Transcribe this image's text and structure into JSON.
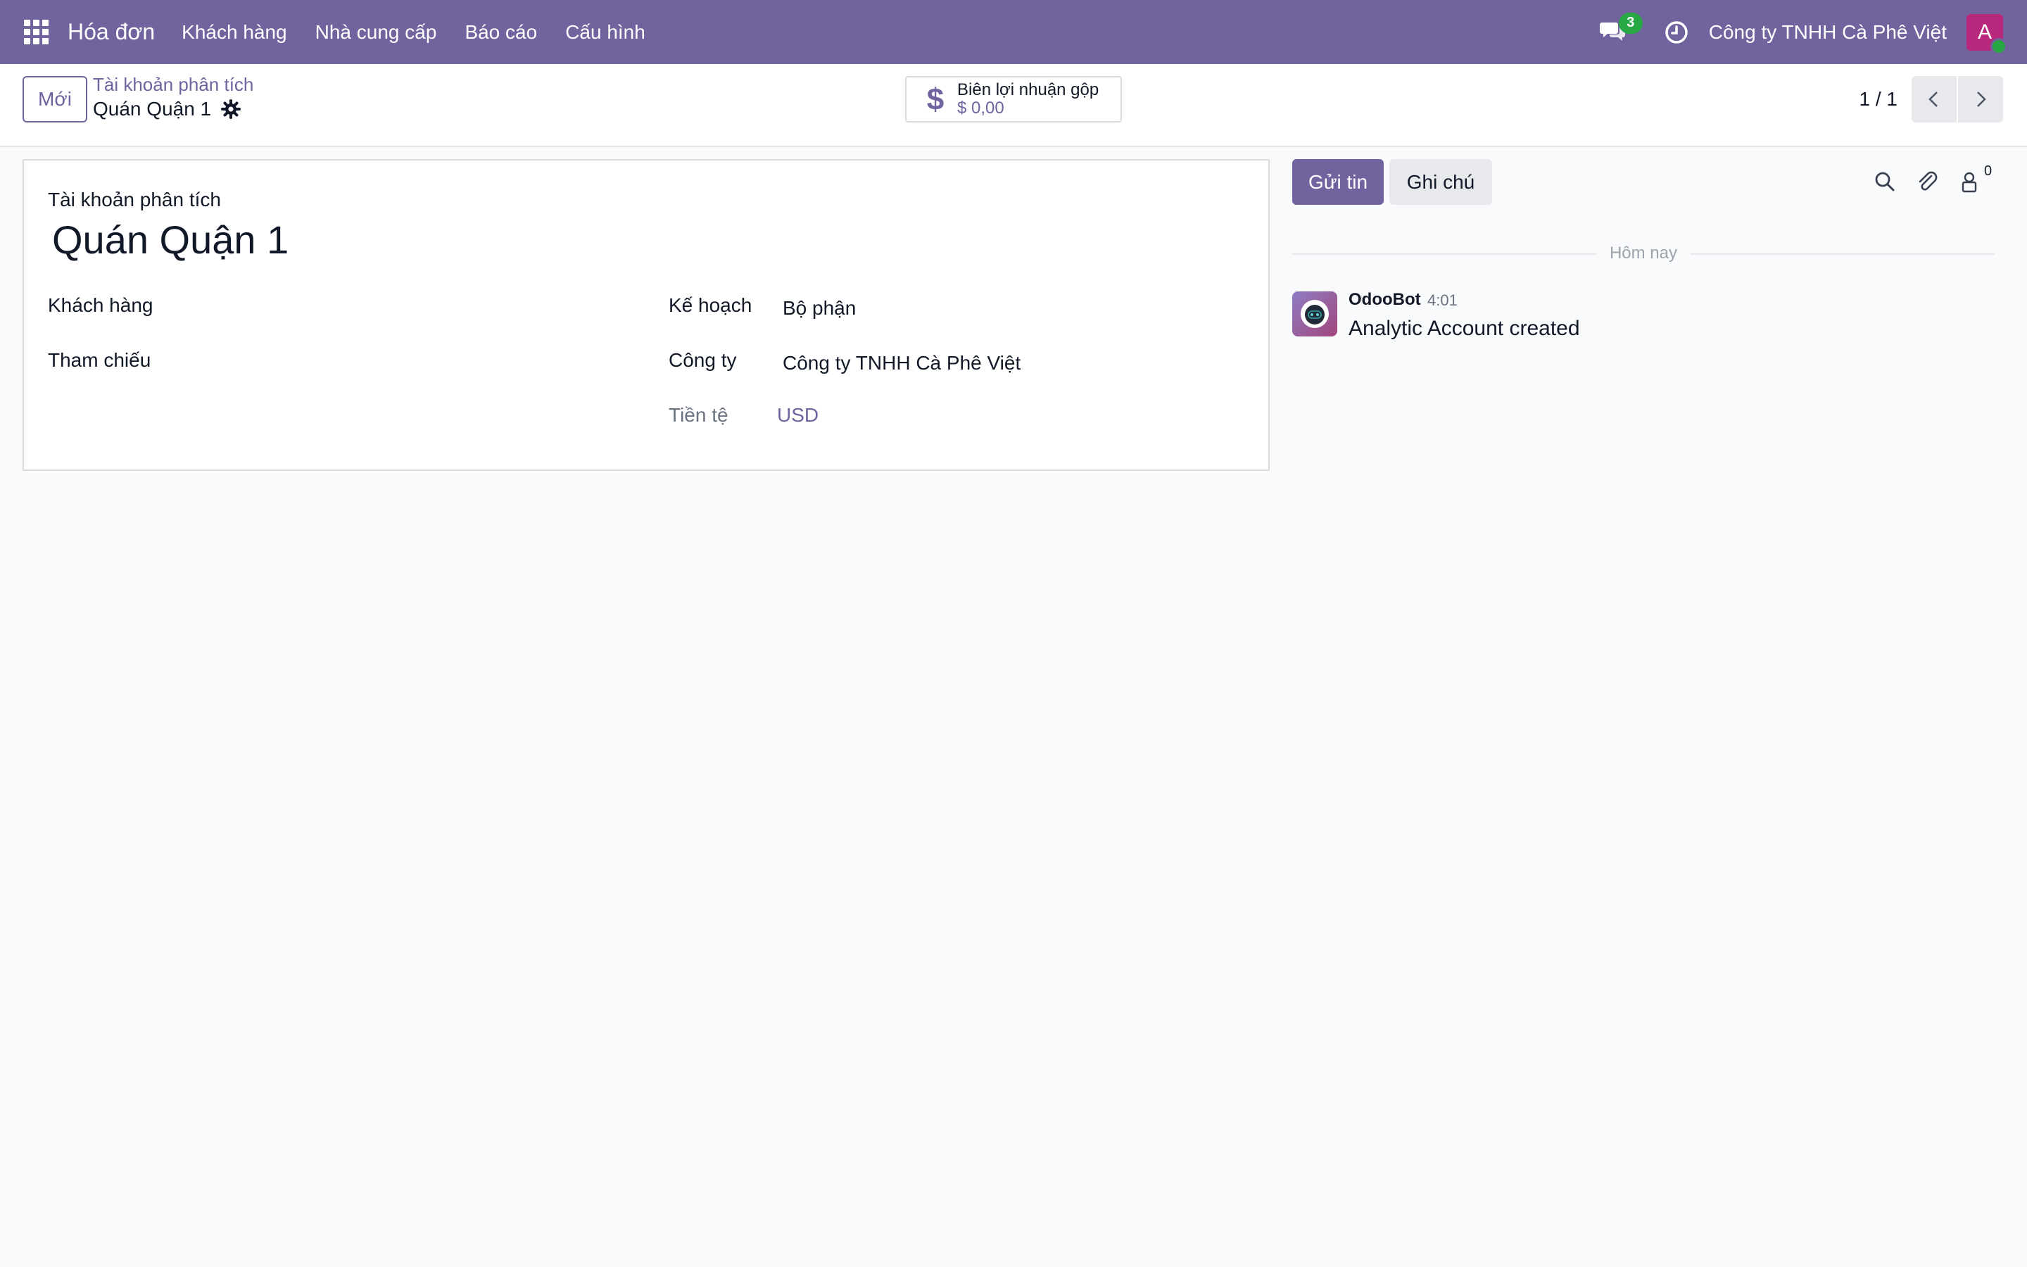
{
  "navbar": {
    "app_name": "Hóa đơn",
    "menu": [
      "Khách hàng",
      "Nhà cung cấp",
      "Báo cáo",
      "Cấu hình"
    ],
    "messages_badge": "3",
    "company": "Công ty TNHH Cà Phê Việt",
    "avatar_letter": "A",
    "color": "#71639e"
  },
  "control_panel": {
    "new_button": "Mới",
    "breadcrumb_parent": "Tài khoản phân tích",
    "breadcrumb_current": "Quán Quận 1",
    "stat_button": {
      "label": "Biên lợi nhuận gộp",
      "value": "$ 0,00"
    },
    "pager": "1 / 1"
  },
  "form": {
    "label": "Tài khoản phân tích",
    "title": "Quán Quận 1",
    "fields": {
      "customer_label": "Khách hàng",
      "reference_label": "Tham chiếu",
      "plan_label": "Kế hoạch",
      "plan_value": "Bộ phận",
      "company_label": "Công ty",
      "company_value": "Công ty TNHH Cà Phê Việt",
      "currency_label": "Tiền tệ",
      "currency_value": "USD"
    }
  },
  "chatter": {
    "send_button": "Gửi tin",
    "note_button": "Ghi chú",
    "followers_count": "0",
    "date_separator": "Hôm nay",
    "messages": [
      {
        "author": "OdooBot",
        "time": "4:01",
        "body": "Analytic Account created"
      }
    ]
  }
}
